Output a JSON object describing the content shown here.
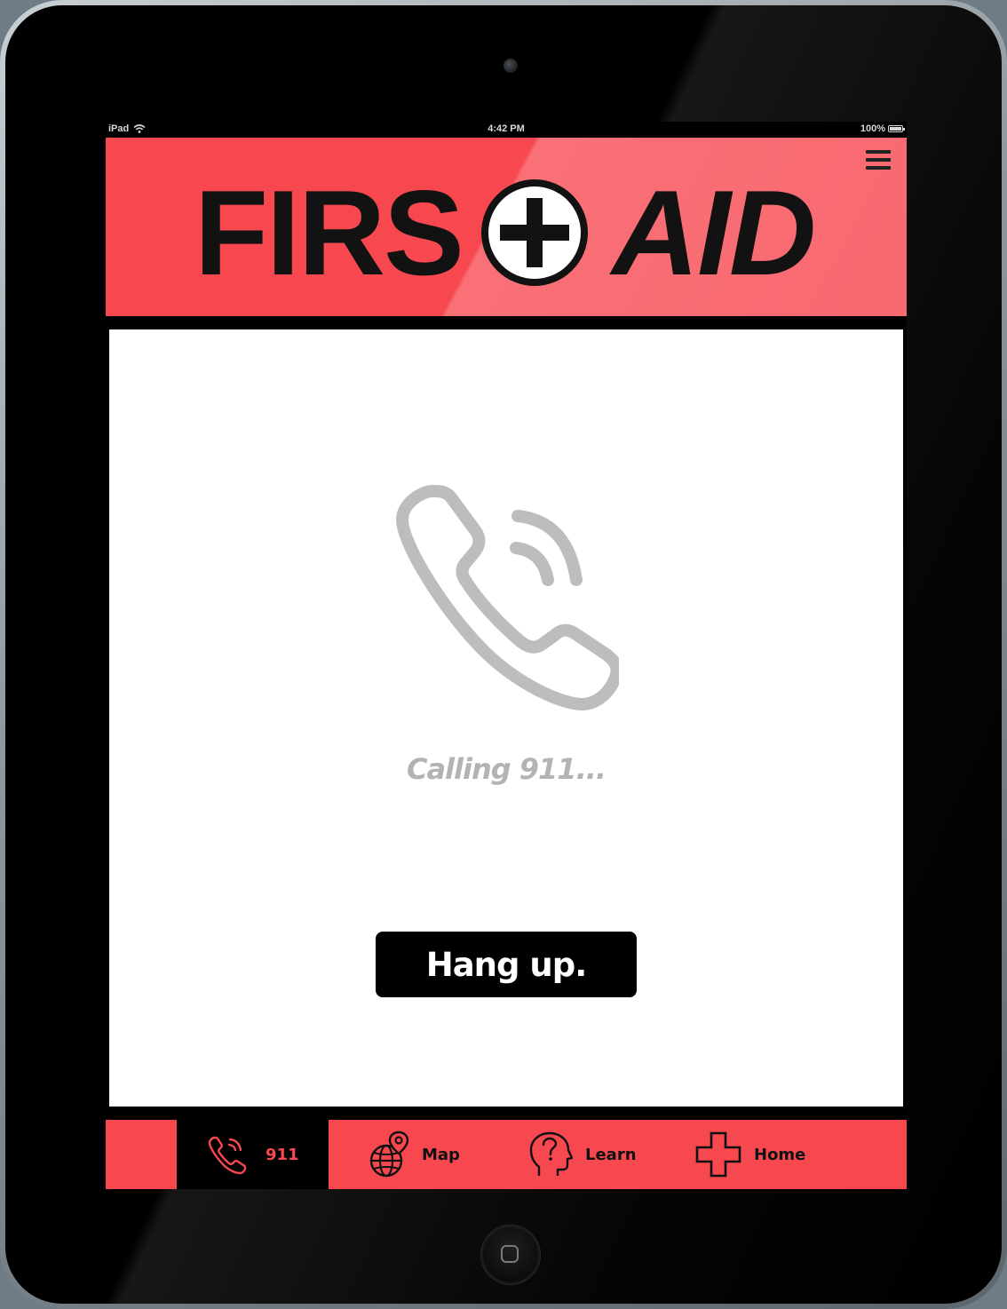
{
  "status_bar": {
    "device": "iPad",
    "time": "4:42 PM",
    "battery": "100%"
  },
  "header": {
    "logo_left": "FIRS",
    "logo_right": "AID",
    "menu_icon": "hamburger-menu-icon"
  },
  "call": {
    "status": "Calling 911...",
    "hangup_label": "Hang up.",
    "icon": "phone-ringing-icon"
  },
  "tabs": [
    {
      "label": "911",
      "icon": "phone-ringing-icon",
      "active": true
    },
    {
      "label": "Map",
      "icon": "globe-pin-icon",
      "active": false
    },
    {
      "label": "Learn",
      "icon": "head-question-icon",
      "active": false
    },
    {
      "label": "Home",
      "icon": "cross-icon",
      "active": false
    }
  ],
  "colors": {
    "brand_red": "#f74850",
    "dark": "#121212",
    "muted_gray": "#b3b3b3"
  }
}
